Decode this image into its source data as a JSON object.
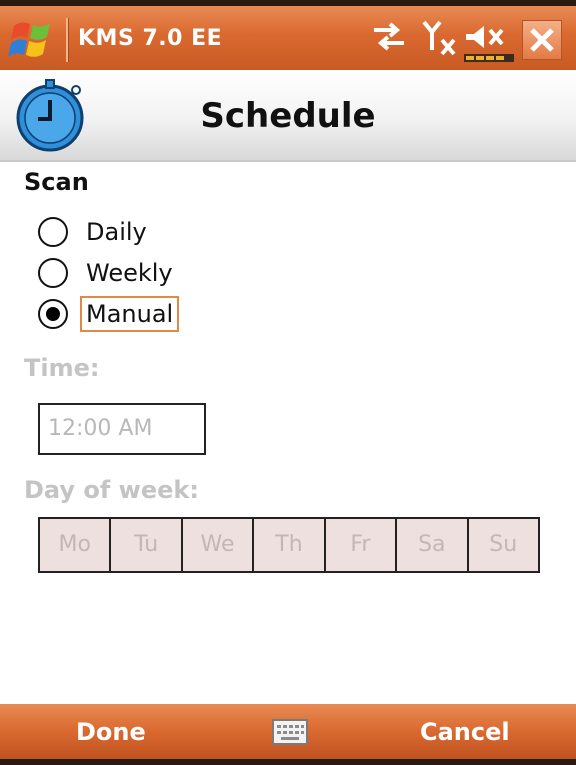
{
  "titlebar": {
    "app_title": "KMS 7.0 EE",
    "icons": [
      "windows-start-icon",
      "sync-arrows-icon",
      "no-signal-icon",
      "volume-muted-icon",
      "battery-icon",
      "close-icon"
    ]
  },
  "header": {
    "title": "Schedule",
    "icon": "stopwatch-icon"
  },
  "scan": {
    "label": "Scan",
    "options": [
      {
        "label": "Daily",
        "selected": false
      },
      {
        "label": "Weekly",
        "selected": false
      },
      {
        "label": "Manual",
        "selected": true
      }
    ]
  },
  "time": {
    "label": "Time:",
    "value": "12:00 AM"
  },
  "day_of_week": {
    "label": "Day of week:",
    "days": [
      "Mo",
      "Tu",
      "We",
      "Th",
      "Fr",
      "Sa",
      "Su"
    ]
  },
  "menubar": {
    "left": "Done",
    "right": "Cancel",
    "center_icon": "keyboard-icon"
  },
  "colors": {
    "accent": "#d9692f",
    "disabled_text": "#c4c4c4",
    "day_cell_bg": "#ede0de",
    "focus_border": "#e08a4a"
  }
}
